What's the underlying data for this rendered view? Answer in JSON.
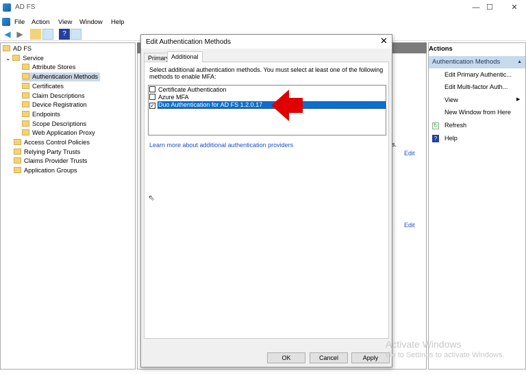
{
  "window": {
    "title": "AD FS",
    "minimize": "—",
    "maximize": "☐",
    "close": "✕"
  },
  "menu": [
    "File",
    "Action",
    "View",
    "Window",
    "Help"
  ],
  "tree": [
    {
      "label": "AD FS",
      "level": 0
    },
    {
      "label": "Service",
      "level": 1,
      "expanded": true
    },
    {
      "label": "Attribute Stores",
      "level": 2
    },
    {
      "label": "Authentication Methods",
      "level": 2,
      "selected": true
    },
    {
      "label": "Certificates",
      "level": 2
    },
    {
      "label": "Claim Descriptions",
      "level": 2
    },
    {
      "label": "Device Registration",
      "level": 2
    },
    {
      "label": "Endpoints",
      "level": 2
    },
    {
      "label": "Scope Descriptions",
      "level": 2
    },
    {
      "label": "Web Application Proxy",
      "level": 2
    },
    {
      "label": "Access Control Policies",
      "level": 1
    },
    {
      "label": "Relying Party Trusts",
      "level": 1
    },
    {
      "label": "Claims Provider Trusts",
      "level": 1
    },
    {
      "label": "Application Groups",
      "level": 1
    }
  ],
  "center": {
    "partial_text": "s.",
    "edit1": "Edit",
    "edit2": "Edit"
  },
  "actions": {
    "header": "Actions",
    "section": "Authentication Methods",
    "items": [
      "Edit Primary Authentic...",
      "Edit Multi-factor Auth...",
      "View",
      "New Window from Here",
      "Refresh",
      "Help"
    ]
  },
  "dialog": {
    "title": "Edit Authentication Methods",
    "close": "✕",
    "tabs": [
      {
        "label": "Primary",
        "active": false
      },
      {
        "label": "Additional",
        "active": true
      }
    ],
    "instruction": "Select additional authentication methods. You must select at least one of the following methods to enable MFA:",
    "methods": [
      {
        "label": "Certificate Authentication",
        "checked": false
      },
      {
        "label": "Azure MFA",
        "checked": false
      },
      {
        "label": "Duo Authentication for AD FS 1.2.0.17",
        "checked": true,
        "selected": true
      }
    ],
    "learn_more": "Learn more about additional authentication providers",
    "ok": "OK",
    "cancel": "Cancel",
    "apply": "Apply"
  },
  "annotation": {
    "arrow_color": "#e00000"
  },
  "watermark": {
    "line1": "Activate Windows",
    "line2": "Go to Settings to activate Windows."
  }
}
